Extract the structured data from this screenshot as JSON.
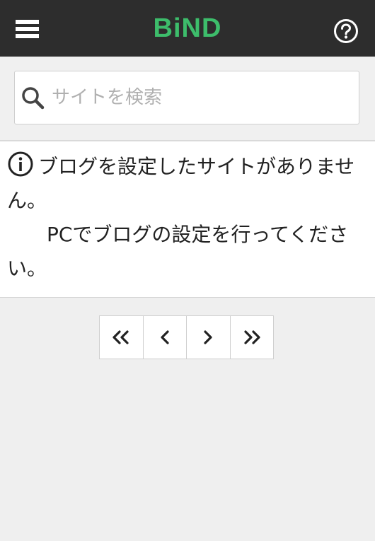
{
  "header": {
    "brand": "BiND",
    "brand_color": "#3dbd6b",
    "bar_color": "#2d2d2d",
    "menu_icon": "hamburger-menu-icon",
    "help_icon": "question-circle-icon"
  },
  "search": {
    "placeholder": "サイトを検索",
    "value": "",
    "icon": "search-icon"
  },
  "message": {
    "icon": "info-circle-icon",
    "line1": "ブログを設定したサイトがありません。",
    "line2": "PCでブログの設定を行ってください。"
  },
  "pagination": {
    "buttons": [
      {
        "icon": "double-chevron-left-icon"
      },
      {
        "icon": "chevron-left-icon"
      },
      {
        "icon": "chevron-right-icon"
      },
      {
        "icon": "double-chevron-right-icon"
      }
    ]
  }
}
